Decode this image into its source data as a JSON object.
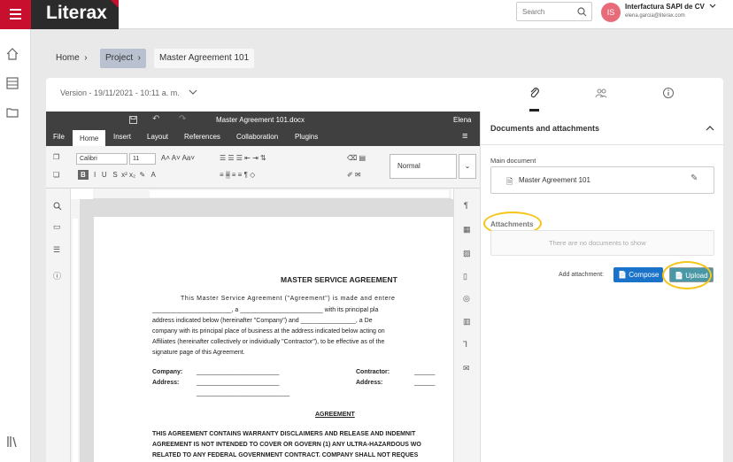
{
  "app": {
    "logo": "Literax"
  },
  "search": {
    "placeholder": "Search"
  },
  "user": {
    "initials": "IS",
    "company": "Interfactura SAPI de CV",
    "email": "elena.garcia@literax.com"
  },
  "breadcrumb": {
    "home": "Home",
    "project": "Project",
    "current": "Master Agreement 101"
  },
  "version": {
    "label": "Version - 19/11/2021 - 10:11 a. m."
  },
  "editor": {
    "filename": "Master Agreement 101.docx",
    "user": "Elena",
    "menu": [
      "File",
      "Home",
      "Insert",
      "Layout",
      "References",
      "Collaboration",
      "Plugins"
    ],
    "font": "Calibri",
    "size": "11",
    "style": "Normal",
    "doc": {
      "title": "MASTER SERVICE AGREEMENT",
      "lines": [
        "This Master Service Agreement (\"Agreement\") is made and entere",
        "_______________________, a ________________________ with its principal pla",
        "address indicated below (hereinafter \"Company\") and ________________, a De",
        "company with its principal place of business at the address indicated below acting on",
        "Affiliates (hereinafter collectively or individually \"Contractor\"), to be effective as of the",
        "signature page of this Agreement."
      ],
      "company_label": "Company:",
      "address_label": "Address:",
      "contractor_label": "Contractor:",
      "address2_label": "Address:",
      "section": "AGREEMENT",
      "caps": [
        "THIS AGREEMENT CONTAINS WARRANTY DISCLAIMERS AND RELEASE AND INDEMNIT",
        "AGREEMENT IS NOT INTENDED TO COVER OR GOVERN (1) ANY ULTRA-HAZARDOUS WO",
        "RELATED TO ANY FEDERAL GOVERNMENT CONTRACT. COMPANY SHALL NOT REQUES"
      ]
    }
  },
  "panel": {
    "title": "Documents and attachments",
    "main_label": "Main document",
    "main_doc": "Master Agreement 101",
    "attachments_label": "Attachments",
    "empty": "There are no documents to show",
    "add_label": "Add attachment:",
    "compose": "Compose",
    "upload": "Upload"
  },
  "colors": {
    "brand": "#c8102e",
    "compose": "#1a73c9",
    "upload": "#4a98a5",
    "highlight": "#f5c518"
  }
}
